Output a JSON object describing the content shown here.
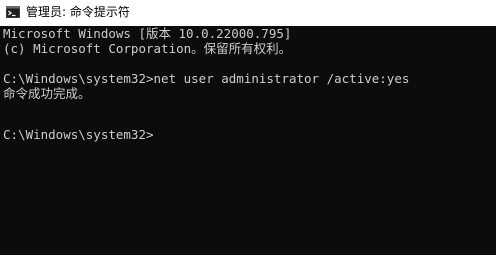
{
  "window": {
    "title": "管理员: 命令提示符",
    "app_icon": "cmd-icon"
  },
  "console": {
    "lines": [
      "Microsoft Windows [版本 10.0.22000.795]",
      "(c) Microsoft Corporation。保留所有权利。",
      "C:\\Windows\\system32>net user administrator /active:yes",
      "命令成功完成。",
      "C:\\Windows\\system32>"
    ]
  },
  "colors": {
    "console_bg": "#0c0c0c",
    "console_text": "#cccccc",
    "titlebar_bg": "#ffffff"
  }
}
